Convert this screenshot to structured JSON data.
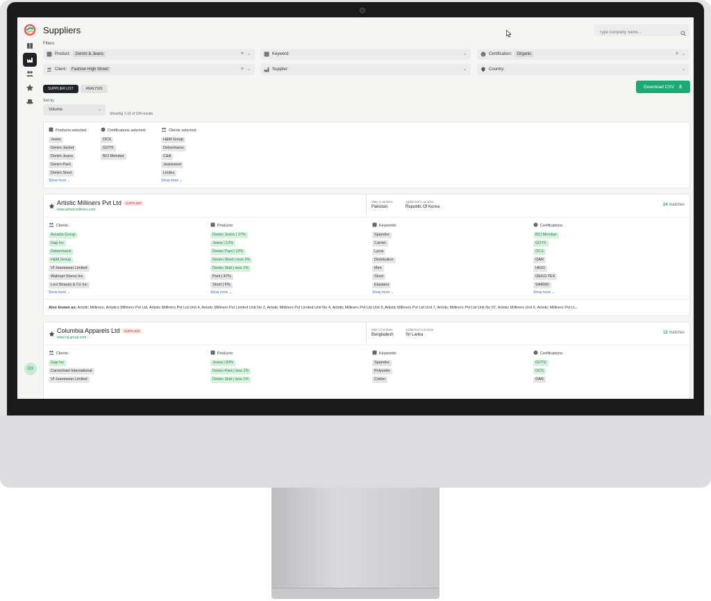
{
  "page": {
    "title": "Suppliers"
  },
  "search": {
    "placeholder": "Type company name..."
  },
  "filters": {
    "label": "Filters",
    "product": {
      "label": "Product:",
      "value": "Denim & Jeans"
    },
    "keyword": {
      "label": "Keyword:"
    },
    "certification": {
      "label": "Certification:",
      "value": "Organic"
    },
    "client": {
      "label": "Client:",
      "value": "Fashion High Street"
    },
    "supplier": {
      "label": "Supplier:"
    },
    "country": {
      "label": "Country:"
    }
  },
  "tabs": {
    "supplier_list": "SUPPLIER LIST",
    "analysis": "ANALYSIS"
  },
  "download": {
    "label": "Download CSV"
  },
  "sort": {
    "label": "Sort by",
    "value": "Volume"
  },
  "results": {
    "count_text": "Showing 1-10 of 134 results"
  },
  "selected": {
    "products_label": "Products selected:",
    "products": [
      "Jeans",
      "Denim Jacket",
      "Denim Jeans",
      "Denim Pant",
      "Denim Short"
    ],
    "certifications_label": "Certifications selected:",
    "certifications": [
      "OCS",
      "GOTS",
      "BCI Member"
    ],
    "clients_label": "Clients selected:",
    "clients": [
      "H&M Group",
      "Debenhams",
      "C&A",
      "Jeanswest",
      "Lindex"
    ],
    "show_more": "Show more"
  },
  "suppliers": [
    {
      "name": "Artistic Milliners Pvt Ltd",
      "badge": "SUPPLIER",
      "url": "www.artisticmilliners.com",
      "main_countries_label": "Main Countries:",
      "main_countries": "Pakistan",
      "additional_countries_label": "Additional Countries:",
      "additional_countries": "Republic Of Korea",
      "matches_count": "24",
      "matches_label": "matches",
      "clients_label": "Clients:",
      "clients": [
        "Arcadia Group",
        "Gap Inc",
        "Debenhams",
        "H&M Group",
        "Vf Jeanswear Limited",
        "Walmart Stores Inc",
        "Levi Strauss & Co Inc"
      ],
      "products_label": "Products:",
      "products": [
        "Denim Jeans | 17%",
        "Jeans | 12%",
        "Denim Pant | 12%",
        "Denim Short | less 1%",
        "Denim Skirt | less 1%",
        "Pant | 47%",
        "Short | 6%"
      ],
      "keywords_label": "Keywords:",
      "keywords": [
        "Spandex",
        "Carrier",
        "Lycra",
        "Distribution",
        "Men",
        "Short",
        "Elastane"
      ],
      "certifications_label": "Certifications:",
      "certifications": [
        "BCI Member",
        "GOTS",
        "OCS",
        "OAR",
        "HIGG",
        "OEKO-TEX",
        "SA8000"
      ],
      "show_more": "Show more",
      "aka_label": "Also known as:",
      "aka_text": "Artistic Milliners, Artistics Milliners Pvt Ltd, Artistic Milliners Pvt Ltd Unit 4, Artistic Milliners Pvt Limited Unit No 2, Artistic Milliners Pvt Limited Unit No 4, Artistic Milliners Pvt Ltd Unit 9, Artistic Milliners Pvt Ltd Unit 7, Artistic Milliners Pvt Ltd Unit No 07, Artistic Milliners Unit 6, Artistic Milliners Pvt Lt..."
    },
    {
      "name": "Columbia Apparels Ltd",
      "badge": "SUPPLIER",
      "url": "www.nij-group.com",
      "main_countries_label": "Main Countries:",
      "main_countries": "Bangladesh",
      "additional_countries_label": "Additional Countries:",
      "additional_countries": "Sri Lanka",
      "matches_count": "12",
      "matches_label": "matches",
      "clients_label": "Clients:",
      "clients": [
        "Gap Inc",
        "Carmichael International",
        "Vf Jeanswear Limited"
      ],
      "products_label": "Products:",
      "products": [
        "Jeans | 83%",
        "Denim Pant | less 1%",
        "Denim Skirt | less 1%"
      ],
      "keywords_label": "Keywords:",
      "keywords": [
        "Spandex",
        "Polyester",
        "Cotton"
      ],
      "certifications_label": "Certifications:",
      "certifications": [
        "GOTS",
        "OCS",
        "OAR"
      ]
    }
  ],
  "colors": {
    "accent": "#1fa774",
    "dark": "#1f2328",
    "badge_red": "#d33"
  },
  "sidebar": {
    "icons": [
      "logo-icon",
      "book-icon",
      "factory-icon",
      "users-icon",
      "star-icon",
      "hat-icon"
    ],
    "avatar": "DS"
  }
}
